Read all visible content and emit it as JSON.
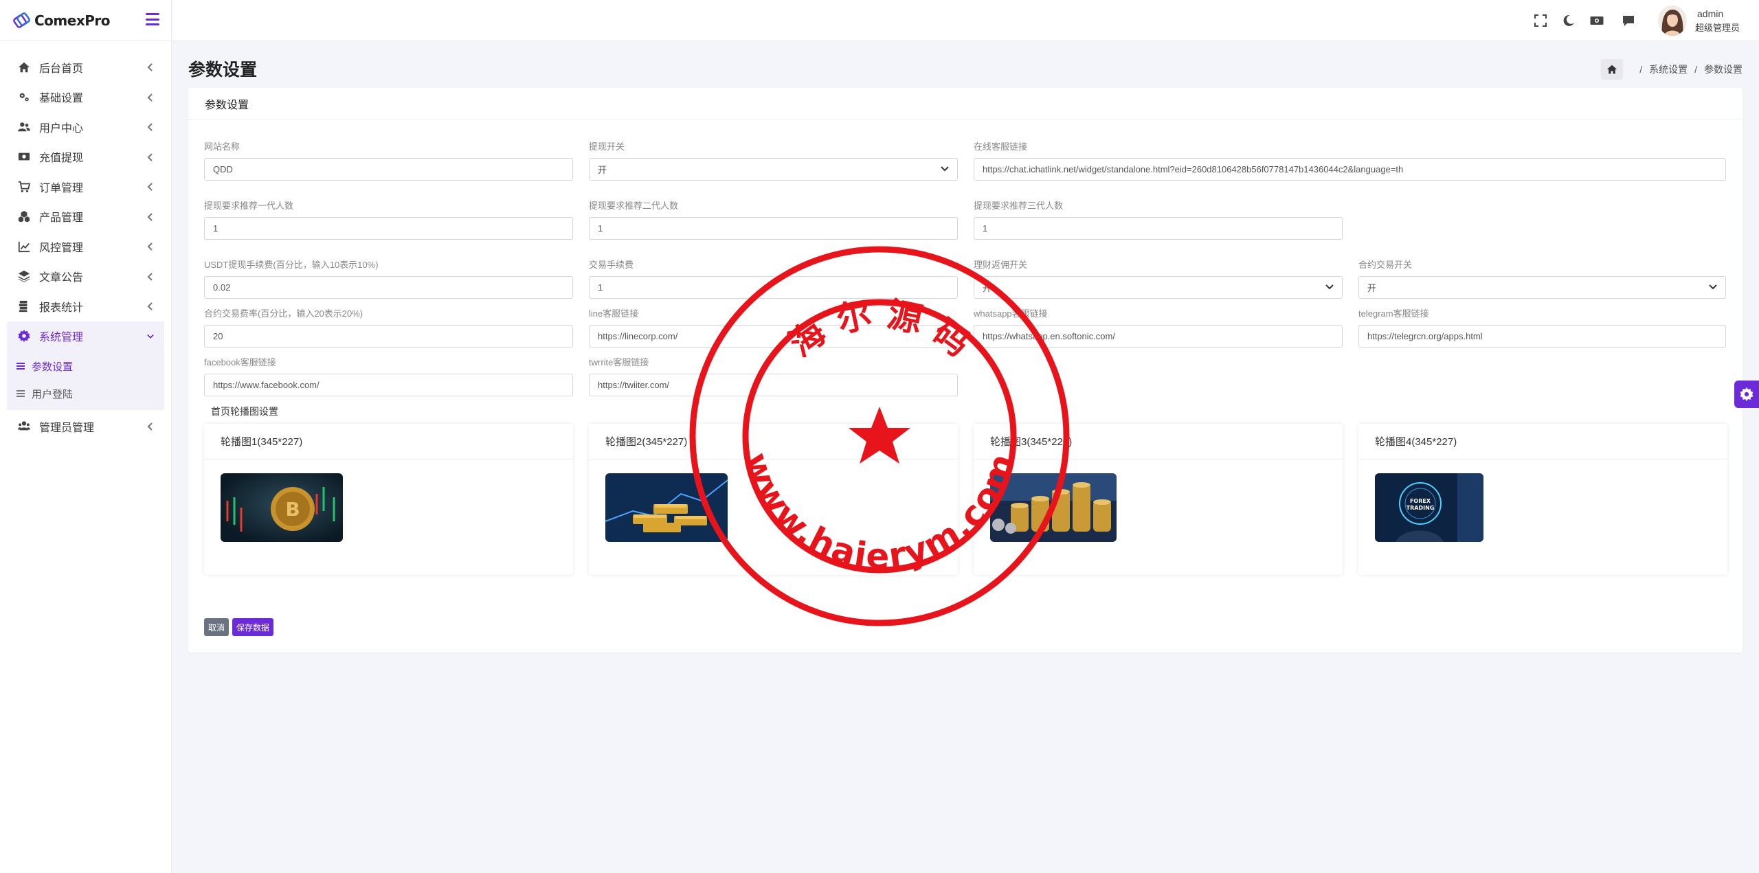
{
  "brand": {
    "name": "ComexPro"
  },
  "sidebar": {
    "items": [
      {
        "label": "后台首页",
        "icon": "home-icon"
      },
      {
        "label": "基础设置",
        "icon": "cogs-icon"
      },
      {
        "label": "用户中心",
        "icon": "users-icon"
      },
      {
        "label": "充值提现",
        "icon": "money-icon"
      },
      {
        "label": "订单管理",
        "icon": "cart-icon"
      },
      {
        "label": "产品管理",
        "icon": "cubes-icon"
      },
      {
        "label": "风控管理",
        "icon": "chart-line-icon"
      },
      {
        "label": "文章公告",
        "icon": "layers-icon"
      },
      {
        "label": "报表统计",
        "icon": "database-icon"
      },
      {
        "label": "系统管理",
        "icon": "gear-icon"
      }
    ],
    "submenu": [
      {
        "label": "参数设置"
      },
      {
        "label": "用户登陆"
      }
    ],
    "last_item": {
      "label": "管理员管理",
      "icon": "users-cog-icon"
    }
  },
  "topbar": {
    "user_name": "admin",
    "user_role": "超级管理员"
  },
  "page": {
    "title": "参数设置",
    "breadcrumb": [
      "系统设置",
      "参数设置"
    ]
  },
  "card": {
    "title": "参数设置",
    "fields": {
      "site_name": {
        "label": "网站名称",
        "value": "QDD"
      },
      "withdraw_switch": {
        "label": "提现开关",
        "value": "开"
      },
      "support_link": {
        "label": "在线客服链接",
        "value": "https://chat.ichatlink.net/widget/standalone.html?eid=260d8106428b56f0778147b1436044c2&language=th"
      },
      "ref1": {
        "label": "提现要求推荐一代人数",
        "value": "1"
      },
      "ref2": {
        "label": "提现要求推荐二代人数",
        "value": "1"
      },
      "ref3": {
        "label": "提现要求推荐三代人数",
        "value": "1"
      },
      "usdt_fee": {
        "label": "USDT提现手续费(百分比，输入10表示10%)",
        "value": "0.02"
      },
      "trade_fee": {
        "label": "交易手续费",
        "value": "1"
      },
      "finance_rebate": {
        "label": "理财返佣开关",
        "value": "开"
      },
      "contract_switch": {
        "label": "合约交易开关",
        "value": "开"
      },
      "contract_rate": {
        "label": "合约交易费率(百分比，输入20表示20%)",
        "value": "20"
      },
      "line_link": {
        "label": "line客服链接",
        "value": "https://linecorp.com/"
      },
      "whatsapp_link": {
        "label": "whatsapp客服链接",
        "value": "https://whatsapp.en.softonic.com/"
      },
      "telegram_link": {
        "label": "telegram客服链接",
        "value": "https://telegrcn.org/apps.html"
      },
      "facebook_link": {
        "label": "facebook客服链接",
        "value": "https://www.facebook.com/"
      },
      "twitter_link": {
        "label": "twrrite客服链接",
        "value": "https://twiiter.com/"
      }
    },
    "banner_section": "首页轮播图设置",
    "banners": [
      {
        "label": "轮播图1(345*227)"
      },
      {
        "label": "轮播图2(345*227)"
      },
      {
        "label": "轮播图3(345*227)"
      },
      {
        "label": "轮播图4(345*227)"
      }
    ],
    "thumb4_text": "FOREX TRADING",
    "cancel_label": "取消",
    "save_label": "保存数据"
  },
  "watermark": {
    "top_text": "海 尔 源 码",
    "bottom_text": "www.haierym.com"
  },
  "colors": {
    "accent": "#6c2bd9",
    "stamp": "#e8141b",
    "cancel": "#6b7280"
  }
}
